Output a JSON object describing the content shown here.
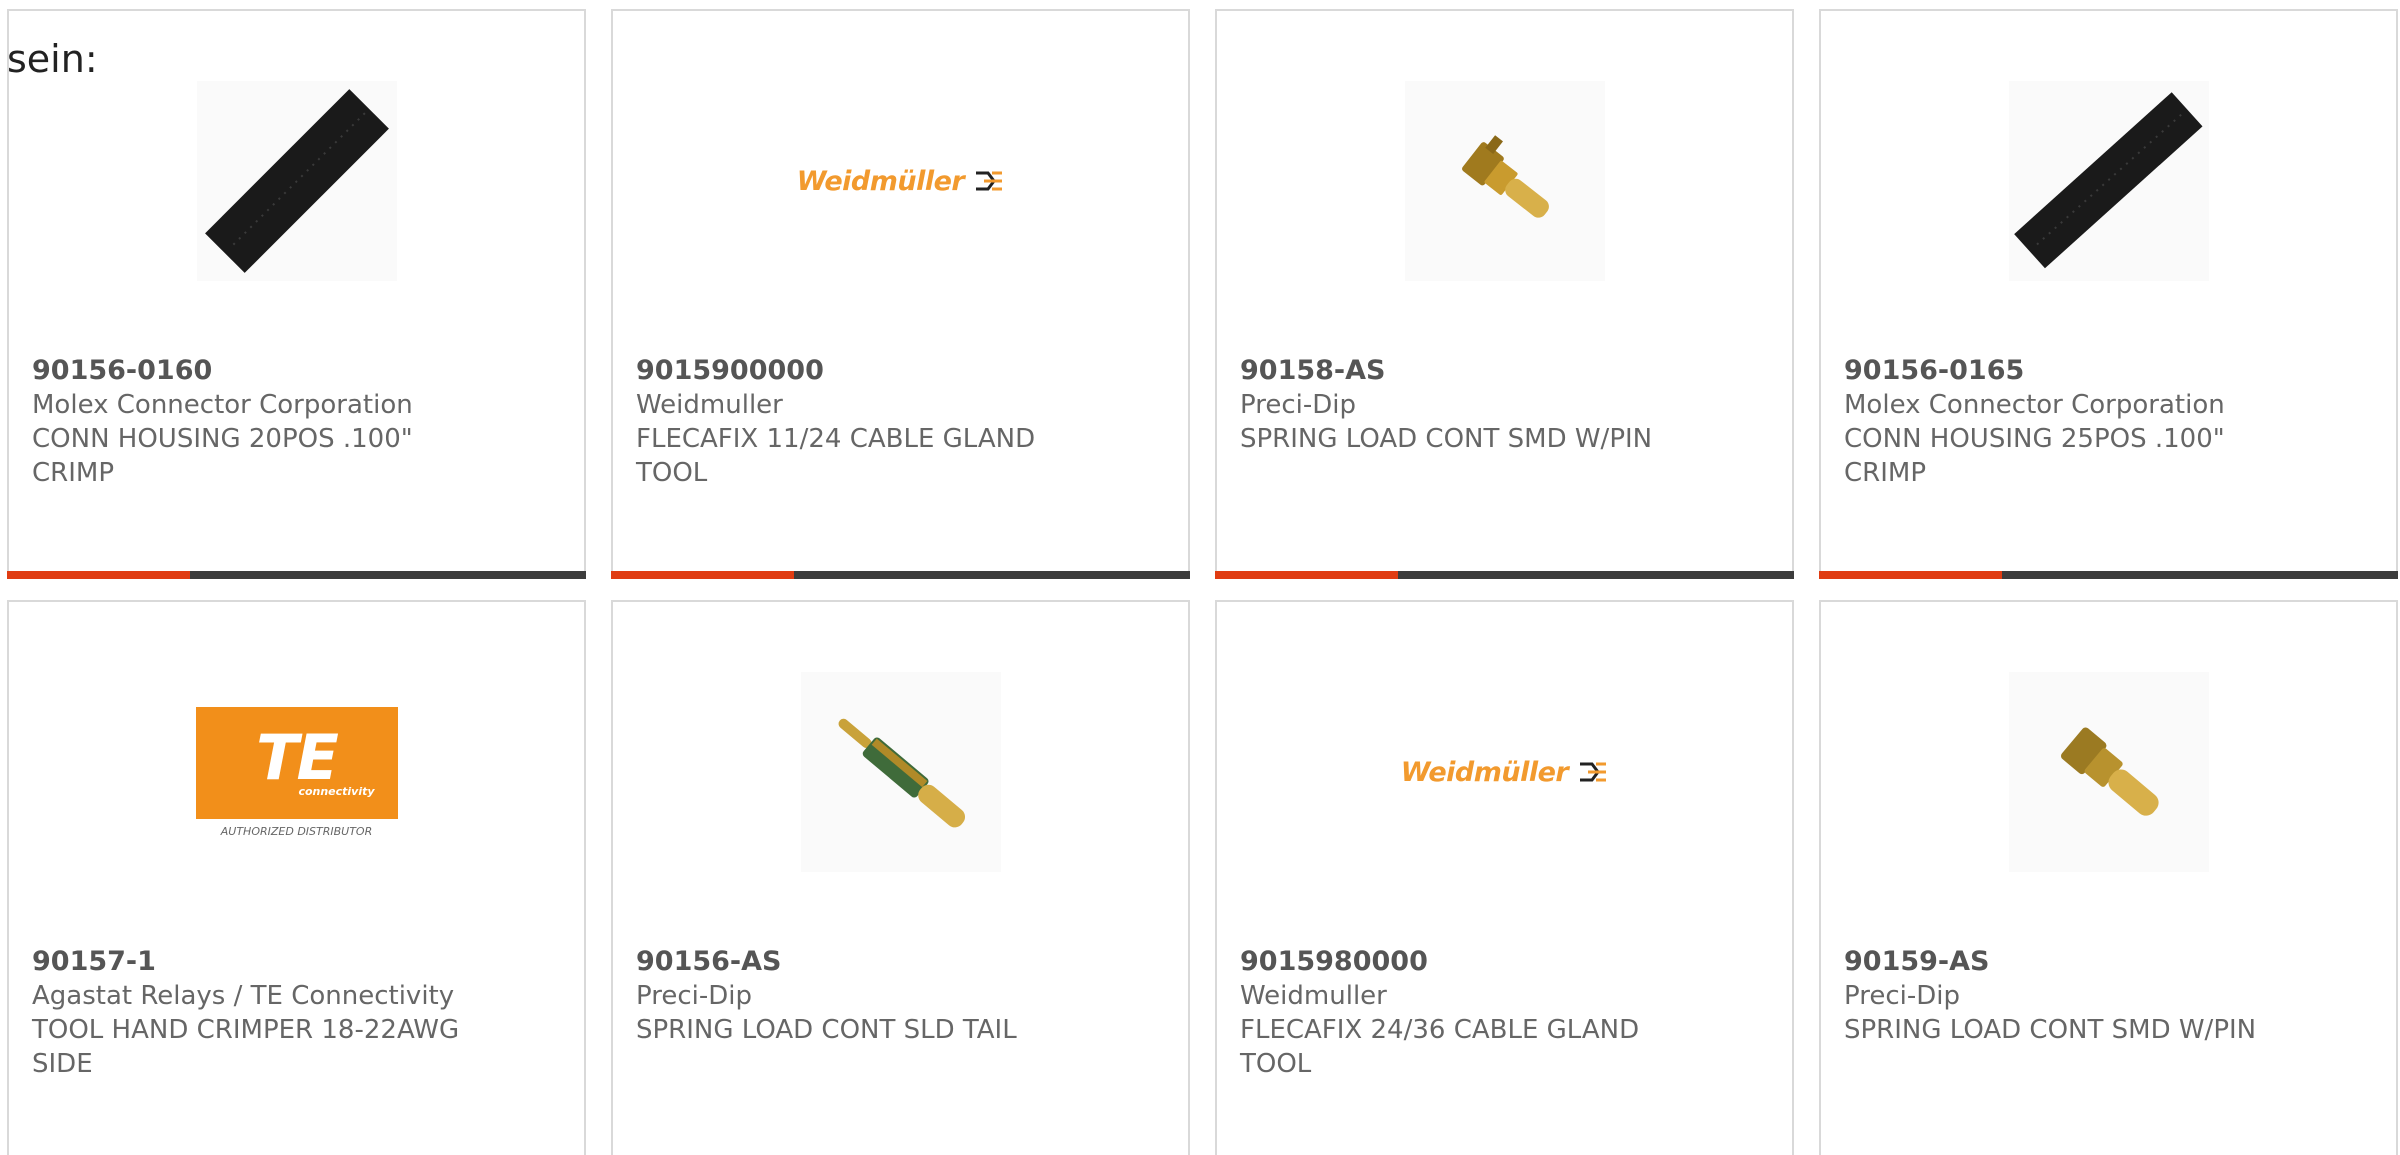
{
  "intro": {
    "text": "sein:"
  },
  "colors": {
    "accent": "#e03c12",
    "bar": "#3c3c3c",
    "card_border": "#d9d9d9",
    "te_orange": "#f28f1a",
    "weidmuller_orange": "#f29a2e"
  },
  "products": [
    {
      "part_number": "90156-0160",
      "manufacturer": "Molex Connector Corporation",
      "description": "CONN HOUSING 20POS .100\" CRIMP",
      "image": "black-connector-housing"
    },
    {
      "part_number": "9015900000",
      "manufacturer": "Weidmuller",
      "description": "FLECAFIX 11/24 CABLE GLAND TOOL",
      "image": "weidmuller-logo",
      "logo_text": "Weidmüller"
    },
    {
      "part_number": "90158-AS",
      "manufacturer": "Preci-Dip",
      "description": "SPRING LOAD CONT SMD W/PIN",
      "image": "gold-spring-contact"
    },
    {
      "part_number": "90156-0165",
      "manufacturer": "Molex Connector Corporation",
      "description": "CONN HOUSING 25POS .100\" CRIMP",
      "image": "black-connector-housing"
    },
    {
      "part_number": "90157-1",
      "manufacturer": "Agastat Relays / TE Connectivity",
      "description": "TOOL HAND CRIMPER 18-22AWG SIDE",
      "image": "te-connectivity-logo",
      "logo_text": "TE",
      "logo_sub": "connectivity",
      "logo_caption": "AUTHORIZED DISTRIBUTOR"
    },
    {
      "part_number": "90156-AS",
      "manufacturer": "Preci-Dip",
      "description": "SPRING LOAD CONT SLD TAIL",
      "image": "gold-spring-pin"
    },
    {
      "part_number": "9015980000",
      "manufacturer": "Weidmuller",
      "description": "FLECAFIX 24/36 CABLE GLAND TOOL",
      "image": "weidmuller-logo",
      "logo_text": "Weidmüller"
    },
    {
      "part_number": "90159-AS",
      "manufacturer": "Preci-Dip",
      "description": "SPRING LOAD CONT SMD W/PIN",
      "image": "gold-spring-contact"
    }
  ]
}
